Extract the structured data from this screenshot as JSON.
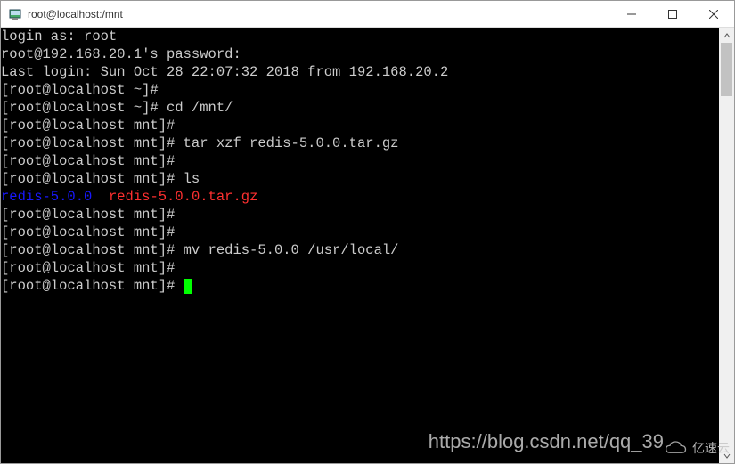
{
  "window": {
    "title": "root@localhost:/mnt"
  },
  "terminal": {
    "lines": [
      {
        "segments": [
          {
            "t": "login as: root",
            "c": ""
          }
        ]
      },
      {
        "segments": [
          {
            "t": "root@192.168.20.1's password:",
            "c": ""
          }
        ]
      },
      {
        "segments": [
          {
            "t": "Last login: Sun Oct 28 22:07:32 2018 from 192.168.20.2",
            "c": ""
          }
        ]
      },
      {
        "segments": [
          {
            "t": "[root@localhost ~]#",
            "c": ""
          }
        ]
      },
      {
        "segments": [
          {
            "t": "[root@localhost ~]# cd /mnt/",
            "c": ""
          }
        ]
      },
      {
        "segments": [
          {
            "t": "[root@localhost mnt]#",
            "c": ""
          }
        ]
      },
      {
        "segments": [
          {
            "t": "[root@localhost mnt]# tar xzf redis-5.0.0.tar.gz",
            "c": ""
          }
        ]
      },
      {
        "segments": [
          {
            "t": "[root@localhost mnt]#",
            "c": ""
          }
        ]
      },
      {
        "segments": [
          {
            "t": "[root@localhost mnt]# ls",
            "c": ""
          }
        ]
      },
      {
        "segments": [
          {
            "t": "redis-5.0.0",
            "c": "dir"
          },
          {
            "t": "  ",
            "c": ""
          },
          {
            "t": "redis-5.0.0.tar.gz",
            "c": "archive"
          }
        ]
      },
      {
        "segments": [
          {
            "t": "[root@localhost mnt]#",
            "c": ""
          }
        ]
      },
      {
        "segments": [
          {
            "t": "[root@localhost mnt]#",
            "c": ""
          }
        ]
      },
      {
        "segments": [
          {
            "t": "[root@localhost mnt]# mv redis-5.0.0 /usr/local/",
            "c": ""
          }
        ]
      },
      {
        "segments": [
          {
            "t": "[root@localhost mnt]#",
            "c": ""
          }
        ]
      },
      {
        "segments": [
          {
            "t": "[root@localhost mnt]# ",
            "c": ""
          }
        ],
        "cursor": true
      }
    ]
  },
  "watermark": {
    "url": "https://blog.csdn.net/qq_39",
    "brand": "亿速云"
  }
}
